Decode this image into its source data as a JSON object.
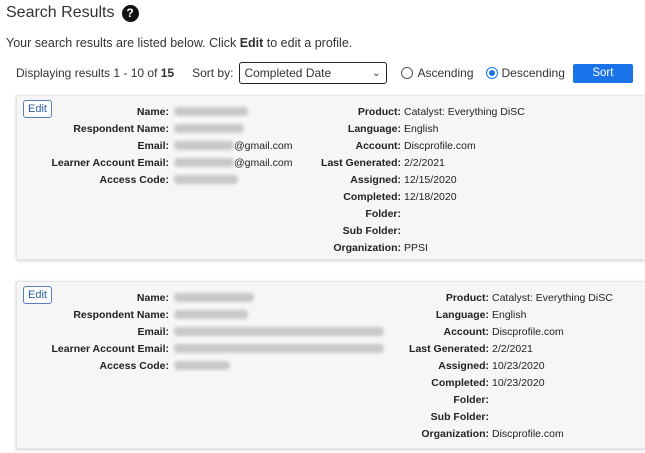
{
  "page": {
    "title": "Search Results",
    "intro_before": "Your search results are listed below. Click ",
    "intro_bold": "Edit",
    "intro_after": " to edit a profile."
  },
  "controls": {
    "displaying_prefix": "Displaying results 1 - 10 of ",
    "total": "15",
    "sort_by_label": "Sort by:",
    "sort_selected": "Completed Date",
    "ascending_label": "Ascending",
    "descending_label": "Descending",
    "selected_order": "Descending",
    "sort_button": "Sort"
  },
  "labels": {
    "name": "Name:",
    "respondent_name": "Respondent Name:",
    "email": "Email:",
    "learner_email": "Learner Account Email:",
    "access_code": "Access Code:",
    "product": "Product:",
    "language": "Language:",
    "account": "Account:",
    "last_generated": "Last Generated:",
    "assigned": "Assigned:",
    "completed": "Completed:",
    "folder": "Folder:",
    "sub_folder": "Sub Folder:",
    "organization": "Organization:"
  },
  "results": [
    {
      "edit_label": "Edit",
      "email_suffix": "@gmail.com",
      "learner_email_suffix": "@gmail.com",
      "product": "Catalyst: Everything DiSC",
      "language": "English",
      "account": "Discprofile.com",
      "last_generated": "2/2/2021",
      "assigned": "12/15/2020",
      "completed": "12/18/2020",
      "folder": "",
      "sub_folder": "",
      "organization": "PPSI"
    },
    {
      "edit_label": "Edit",
      "email_suffix": "",
      "learner_email_suffix": "",
      "product": "Catalyst: Everything DiSC",
      "language": "English",
      "account": "Discprofile.com",
      "last_generated": "2/2/2021",
      "assigned": "10/23/2020",
      "completed": "10/23/2020",
      "folder": "",
      "sub_folder": "",
      "organization": "Discprofile.com"
    }
  ],
  "colors": {
    "accent": "#1a73e8",
    "card_background": "#f6f6f6"
  }
}
